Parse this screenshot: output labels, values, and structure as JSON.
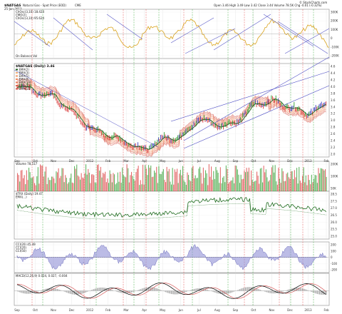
{
  "header": {
    "symbol": "$NATGAS",
    "name": "Natural Gas - Spot Price (EOD)",
    "exchange": "CME",
    "watermark": "© StockCharts.com",
    "date": "25-Jan-2013",
    "quote": "Open 3.46  High 3.49  Low 3.42  Close 3.44  Volume 78.5K  Chg -0.01 (-0.32%)"
  },
  "chart_data": [
    {
      "type": "line",
      "panel": "ChOsc",
      "legend": [
        "ChOsc(3,10) 18.424",
        "CMO(2)",
        "ChOsc(3,10) 95.624"
      ],
      "overlay_label": "On Balance Vol",
      "y_ticks": [
        "300K",
        "200K",
        "100K",
        "0",
        "-100K",
        "-200K"
      ],
      "colors": {
        "line": "#d9a21a"
      }
    },
    {
      "type": "line",
      "panel": "price",
      "title": "$NATGAS (Daily) 3.46",
      "legend": [
        "EMA(2)",
        "EMA(3)",
        "EMA(5)",
        "EMA(8)",
        "EMA(10)",
        "EMA(12)",
        "EMA(15)"
      ],
      "y_ticks": [
        "4.6",
        "4.4",
        "4.2",
        "4.0",
        "3.8",
        "3.6",
        "3.4",
        "3.2",
        "3.0",
        "2.8",
        "2.6",
        "2.4",
        "2.2",
        "2.0"
      ],
      "ylim": [
        1.9,
        4.7
      ],
      "x_ticks": [
        "Sep",
        "Oct",
        "Nov",
        "Dec",
        "2012",
        "Feb",
        "Mar",
        "Apr",
        "May",
        "Jun",
        "Jul",
        "Aug",
        "Sep",
        "Oct",
        "Nov",
        "Dec",
        "2013",
        "Feb"
      ],
      "month_end_price": [
        4.1,
        3.85,
        3.7,
        3.25,
        2.75,
        2.55,
        2.35,
        2.1,
        2.45,
        2.5,
        3.05,
        2.85,
        2.9,
        3.45,
        3.6,
        3.4,
        3.2,
        3.46
      ]
    },
    {
      "type": "bar",
      "panel": "volume",
      "legend": "Volume 78,517",
      "y_ticks": [
        "200K",
        "100K",
        "50K"
      ]
    },
    {
      "type": "line",
      "panel": "ratio",
      "legend": [
        "$TRX (Daily) 19.47",
        "EMA(...)"
      ],
      "y_ticks": [
        "28.5",
        "27.5",
        "27.0",
        "26.5",
        "26.0",
        "25.5",
        "25.0"
      ],
      "colors": {
        "line": "#1e6b1e"
      }
    },
    {
      "type": "area",
      "panel": "CCI",
      "legend": [
        "CCI(20) 45.49",
        "CCI(20)",
        "CCI(50)"
      ],
      "y_ticks": [
        "200",
        "100",
        "0",
        "-100",
        "-200"
      ],
      "colors": {
        "fill": "#8f8fd6"
      }
    },
    {
      "type": "line",
      "panel": "MACD",
      "legend": "MACD(12,26,9) 0.024, 0.027, -0.004",
      "colors": {
        "macd": "#000000",
        "signal": "#d04040"
      }
    }
  ]
}
